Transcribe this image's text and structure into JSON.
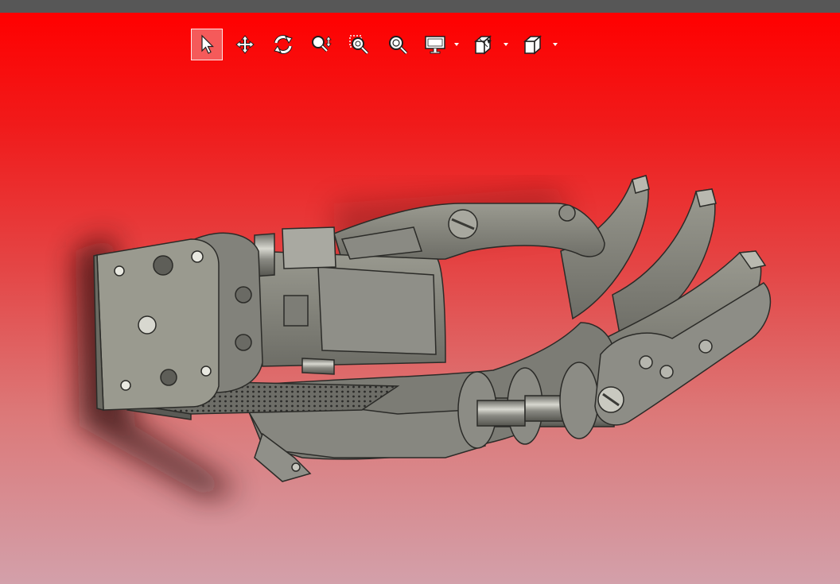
{
  "window": {
    "titlebar_color": "#575757"
  },
  "viewport": {
    "background_top": "#ff0000",
    "background_bottom": "#d3a0aa",
    "model_description_name": "robotic-gripper-model"
  },
  "toolbar": {
    "tools": [
      {
        "name": "select-tool-button",
        "icon": "arrow-pointer-icon",
        "active": true,
        "dropdown": false
      },
      {
        "name": "pan-tool-button",
        "icon": "four-way-arrows-icon",
        "active": false,
        "dropdown": false
      },
      {
        "name": "rotate-tool-button",
        "icon": "rotate-arrows-icon",
        "active": false,
        "dropdown": false
      },
      {
        "name": "zoom-tool-button",
        "icon": "zoom-updown-icon",
        "active": false,
        "dropdown": false
      },
      {
        "name": "zoom-window-button",
        "icon": "zoom-window-icon",
        "active": false,
        "dropdown": false
      },
      {
        "name": "zoom-fit-button",
        "icon": "zoom-fit-icon",
        "active": false,
        "dropdown": false
      },
      {
        "name": "display-mode-button",
        "icon": "monitor-icon",
        "active": false,
        "dropdown": true
      },
      {
        "name": "section-view-button",
        "icon": "section-box-icon",
        "active": false,
        "dropdown": true
      },
      {
        "name": "standard-views-button",
        "icon": "cube-icon",
        "active": false,
        "dropdown": true
      }
    ],
    "accent_color": "#f55a5a",
    "icon_color": "#ffffff"
  }
}
